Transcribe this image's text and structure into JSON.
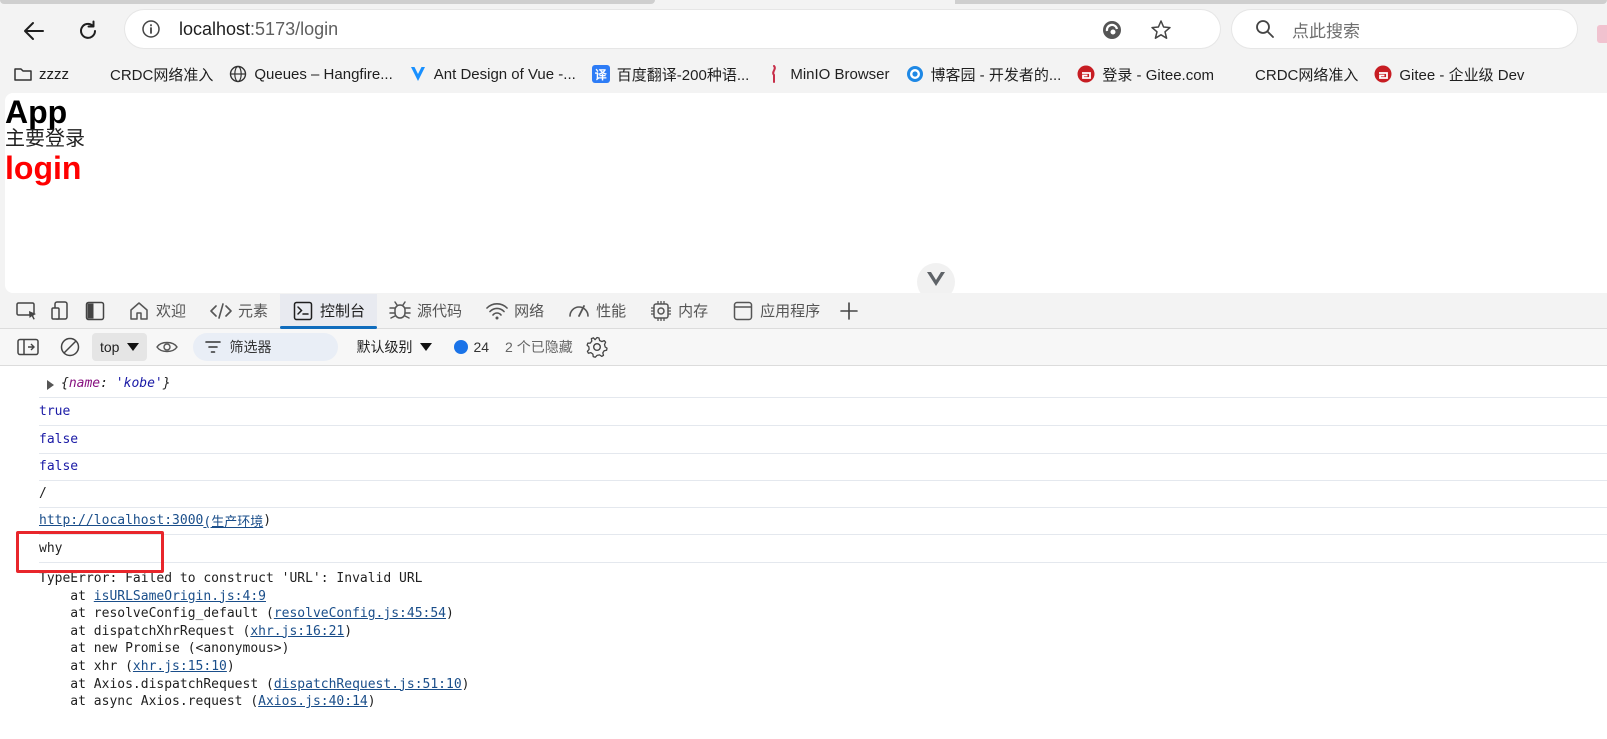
{
  "browser": {
    "url_host": "localhost",
    "url_path": ":5173/login",
    "search_placeholder": "点此搜索"
  },
  "bookmarks": [
    {
      "label": "zzzz",
      "icon": "folder-icon"
    },
    {
      "label": "CRDC网络准入",
      "icon": "blank-page-icon"
    },
    {
      "label": "Queues – Hangfire...",
      "icon": "globe-icon"
    },
    {
      "label": "Ant Design of Vue -...",
      "icon": "vue-icon"
    },
    {
      "label": "百度翻译-200种语...",
      "icon": "translate-icon",
      "icon_text": "译"
    },
    {
      "label": "MinIO Browser",
      "icon": "minio-icon"
    },
    {
      "label": "博客园 - 开发者的...",
      "icon": "cnblogs-icon"
    },
    {
      "label": "登录 - Gitee.com",
      "icon": "gitee-icon"
    },
    {
      "label": "CRDC网络准入",
      "icon": "blank-page-icon"
    },
    {
      "label": "Gitee - 企业级 Dev",
      "icon": "gitee-icon"
    }
  ],
  "page": {
    "title": "App",
    "subtitle": "主要登录",
    "route_text": "login"
  },
  "devtools": {
    "tabs": [
      {
        "label": "欢迎",
        "icon": "home-icon"
      },
      {
        "label": "元素",
        "icon": "code-icon"
      },
      {
        "label": "控制台",
        "icon": "console-icon",
        "active": true
      },
      {
        "label": "源代码",
        "icon": "bug-icon"
      },
      {
        "label": "网络",
        "icon": "wifi-icon"
      },
      {
        "label": "性能",
        "icon": "gauge-icon"
      },
      {
        "label": "内存",
        "icon": "chip-icon"
      },
      {
        "label": "应用程序",
        "icon": "window-icon"
      }
    ],
    "console_toolbar": {
      "context": "top",
      "filter_placeholder": "筛选器",
      "level": "默认级别",
      "message_count": "24",
      "hidden_count": "2 个已隐藏"
    }
  },
  "console": {
    "obj": {
      "open": "{",
      "key": "name",
      "sep": ": ",
      "value": "'kobe'",
      "close": "}"
    },
    "lines": [
      "true",
      "false",
      "false",
      "/"
    ],
    "link_line": {
      "link1": "http://localhost:3000",
      "link2": "(生产环境",
      "tail": ")"
    },
    "highlighted": "why",
    "error": {
      "message": "TypeError: Failed to construct 'URL': Invalid URL",
      "stack": [
        {
          "prefix": "    at ",
          "link": "isURLSameOrigin.js:4:9",
          "suffix": ""
        },
        {
          "prefix": "    at resolveConfig_default (",
          "link": "resolveConfig.js:45:54",
          "suffix": ")"
        },
        {
          "prefix": "    at dispatchXhrRequest (",
          "link": "xhr.js:16:21",
          "suffix": ")"
        },
        {
          "prefix": "    at new Promise (<anonymous>)",
          "link": "",
          "suffix": ""
        },
        {
          "prefix": "    at xhr (",
          "link": "xhr.js:15:10",
          "suffix": ")"
        },
        {
          "prefix": "    at Axios.dispatchRequest (",
          "link": "dispatchRequest.js:51:10",
          "suffix": ")"
        },
        {
          "prefix": "    at async Axios.request (",
          "link": "Axios.js:40:14",
          "suffix": ")"
        }
      ]
    }
  },
  "colors": {
    "accent": "#0f6cbd",
    "route_red": "#ff0000",
    "annotation_red": "#e8262b",
    "console_value_blue": "#1a1aa6"
  }
}
